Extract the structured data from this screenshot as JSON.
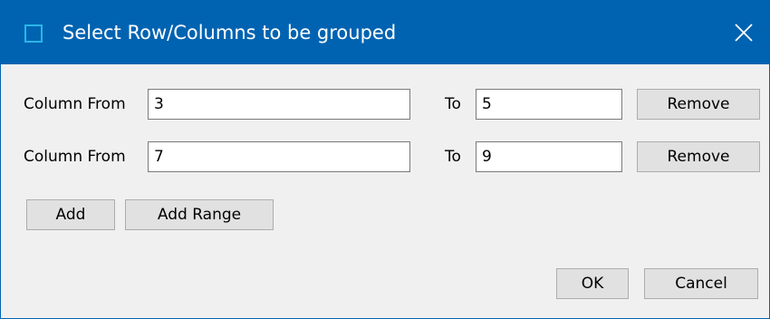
{
  "window": {
    "title": "Select Row/Columns to be grouped",
    "close_glyph": "✕",
    "title_icon": "window-icon",
    "accent_color": "#0063b1"
  },
  "rows": [
    {
      "from_label": "Column From",
      "from_value": "3",
      "to_label": "To",
      "to_value": "5",
      "remove_label": "Remove"
    },
    {
      "from_label": "Column From",
      "from_value": "7",
      "to_label": "To",
      "to_value": "9",
      "remove_label": "Remove"
    }
  ],
  "actions": {
    "add_label": "Add",
    "add_range_label": "Add Range"
  },
  "footer": {
    "ok_label": "OK",
    "cancel_label": "Cancel"
  }
}
